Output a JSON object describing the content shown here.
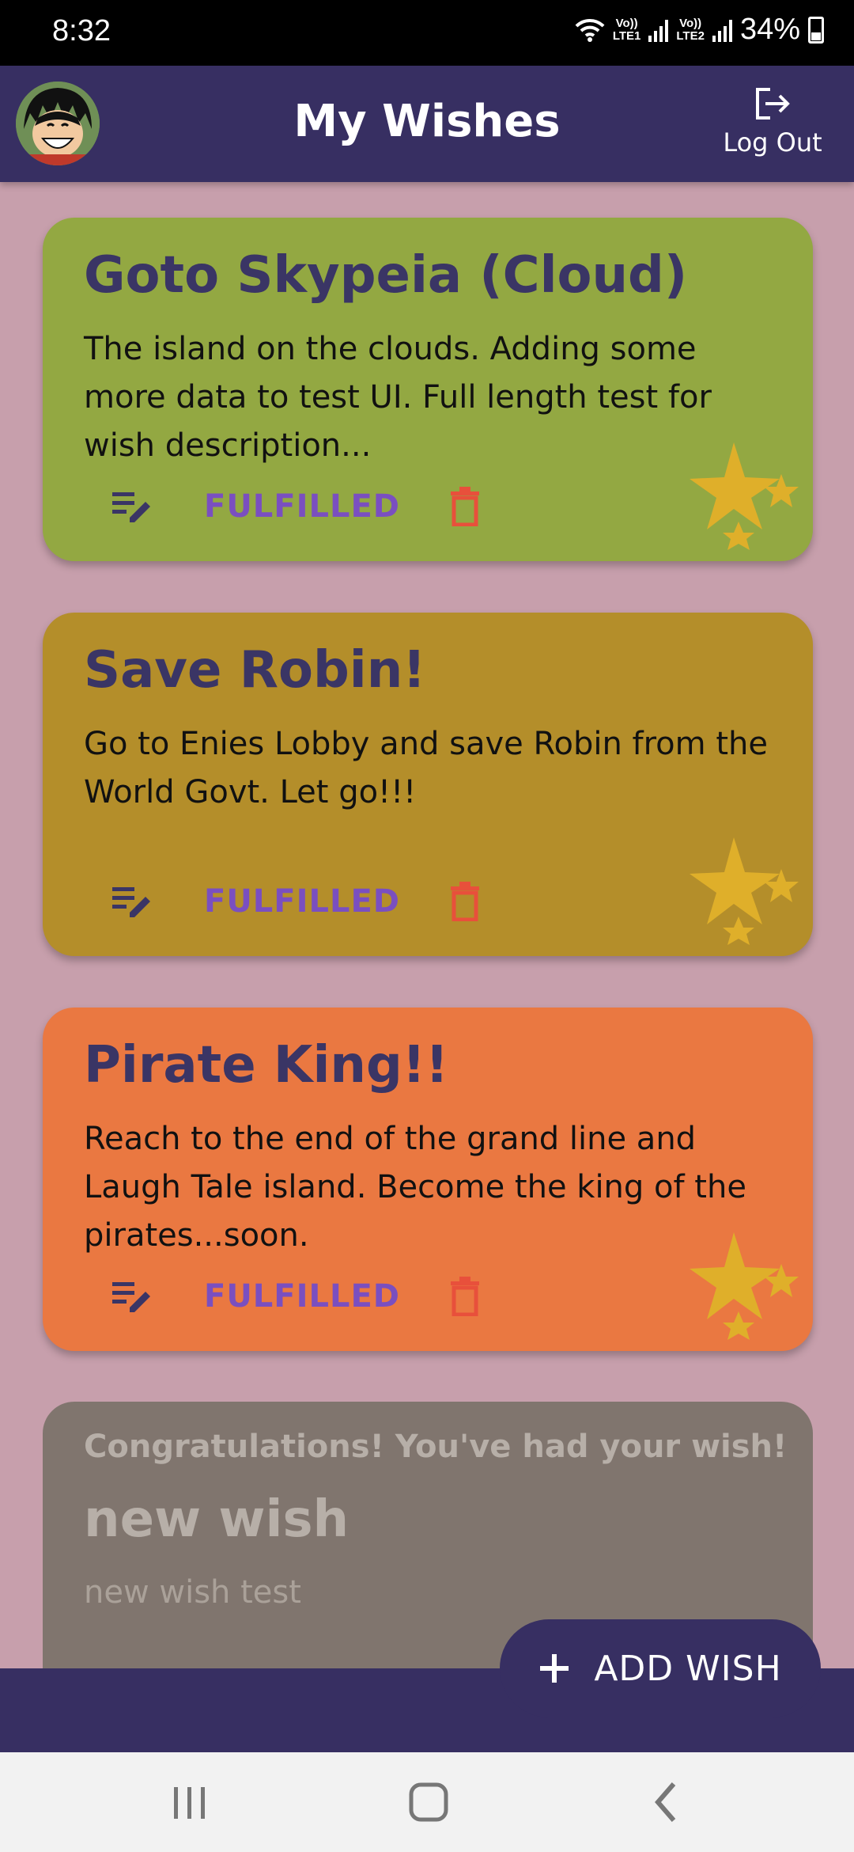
{
  "status_bar": {
    "time": "8:32",
    "lte1": "Vo))\nLTE1",
    "lte2": "Vo))\nLTE2",
    "battery": "34%"
  },
  "app_bar": {
    "title": "My Wishes",
    "logout_label": "Log Out",
    "avatar_icon": "avatar-luffy",
    "logout_icon": "logout-icon"
  },
  "wishes": [
    {
      "title": "Goto Skypeia (Cloud)",
      "description": "The island on the clouds. Adding some more data to test UI. Full length test for wish description...",
      "fulfill_label": "FULFILLED",
      "color": "#93a842"
    },
    {
      "title": "Save Robin!",
      "description": "Go to Enies Lobby and save Robin from the World Govt. Let go!!!",
      "fulfill_label": "FULFILLED",
      "color": "#b48e2a"
    },
    {
      "title": "Pirate King!!",
      "description": "Reach to the end of the grand line and Laugh Tale island. Become the king of the pirates...soon.",
      "fulfill_label": "FULFILLED",
      "color": "#ea7841"
    }
  ],
  "fulfilled_wish": {
    "congrats": "Congratulations! You've had your wish!",
    "title": "new wish",
    "description": "new wish test",
    "color": "#80756e"
  },
  "fab": {
    "label": "ADD WISH",
    "icon": "plus-icon"
  },
  "colors": {
    "app_bar": "#372f62",
    "background": "#c79fac",
    "star": "#dfaf2a",
    "delete": "#e8503b",
    "fulfill_text": "#7a4fc0"
  }
}
